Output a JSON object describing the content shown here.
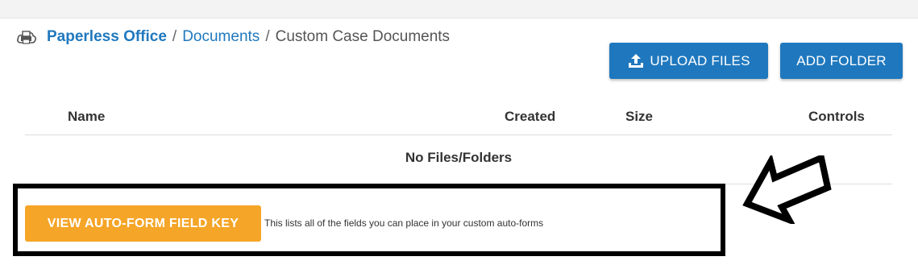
{
  "breadcrumb": {
    "icon": "cloud-printer-icon",
    "home": "Paperless Office",
    "separator": "/",
    "documents": "Documents",
    "current": "Custom Case Documents"
  },
  "actions": {
    "upload_label": "UPLOAD FILES",
    "upload_icon": "upload-icon",
    "add_folder_label": "ADD FOLDER"
  },
  "table": {
    "columns": [
      "Name",
      "Created",
      "Size",
      "Controls"
    ],
    "empty_message": "No Files/Folders"
  },
  "field_key": {
    "button_label": "VIEW AUTO-FORM FIELD KEY",
    "description": "This lists all of the fields you can place in your custom auto-forms"
  },
  "annotation": {
    "arrow_icon": "arrow-pointer-icon"
  },
  "colors": {
    "primary": "#1f78be",
    "accent": "#f5a527",
    "annotation": "#000000"
  }
}
